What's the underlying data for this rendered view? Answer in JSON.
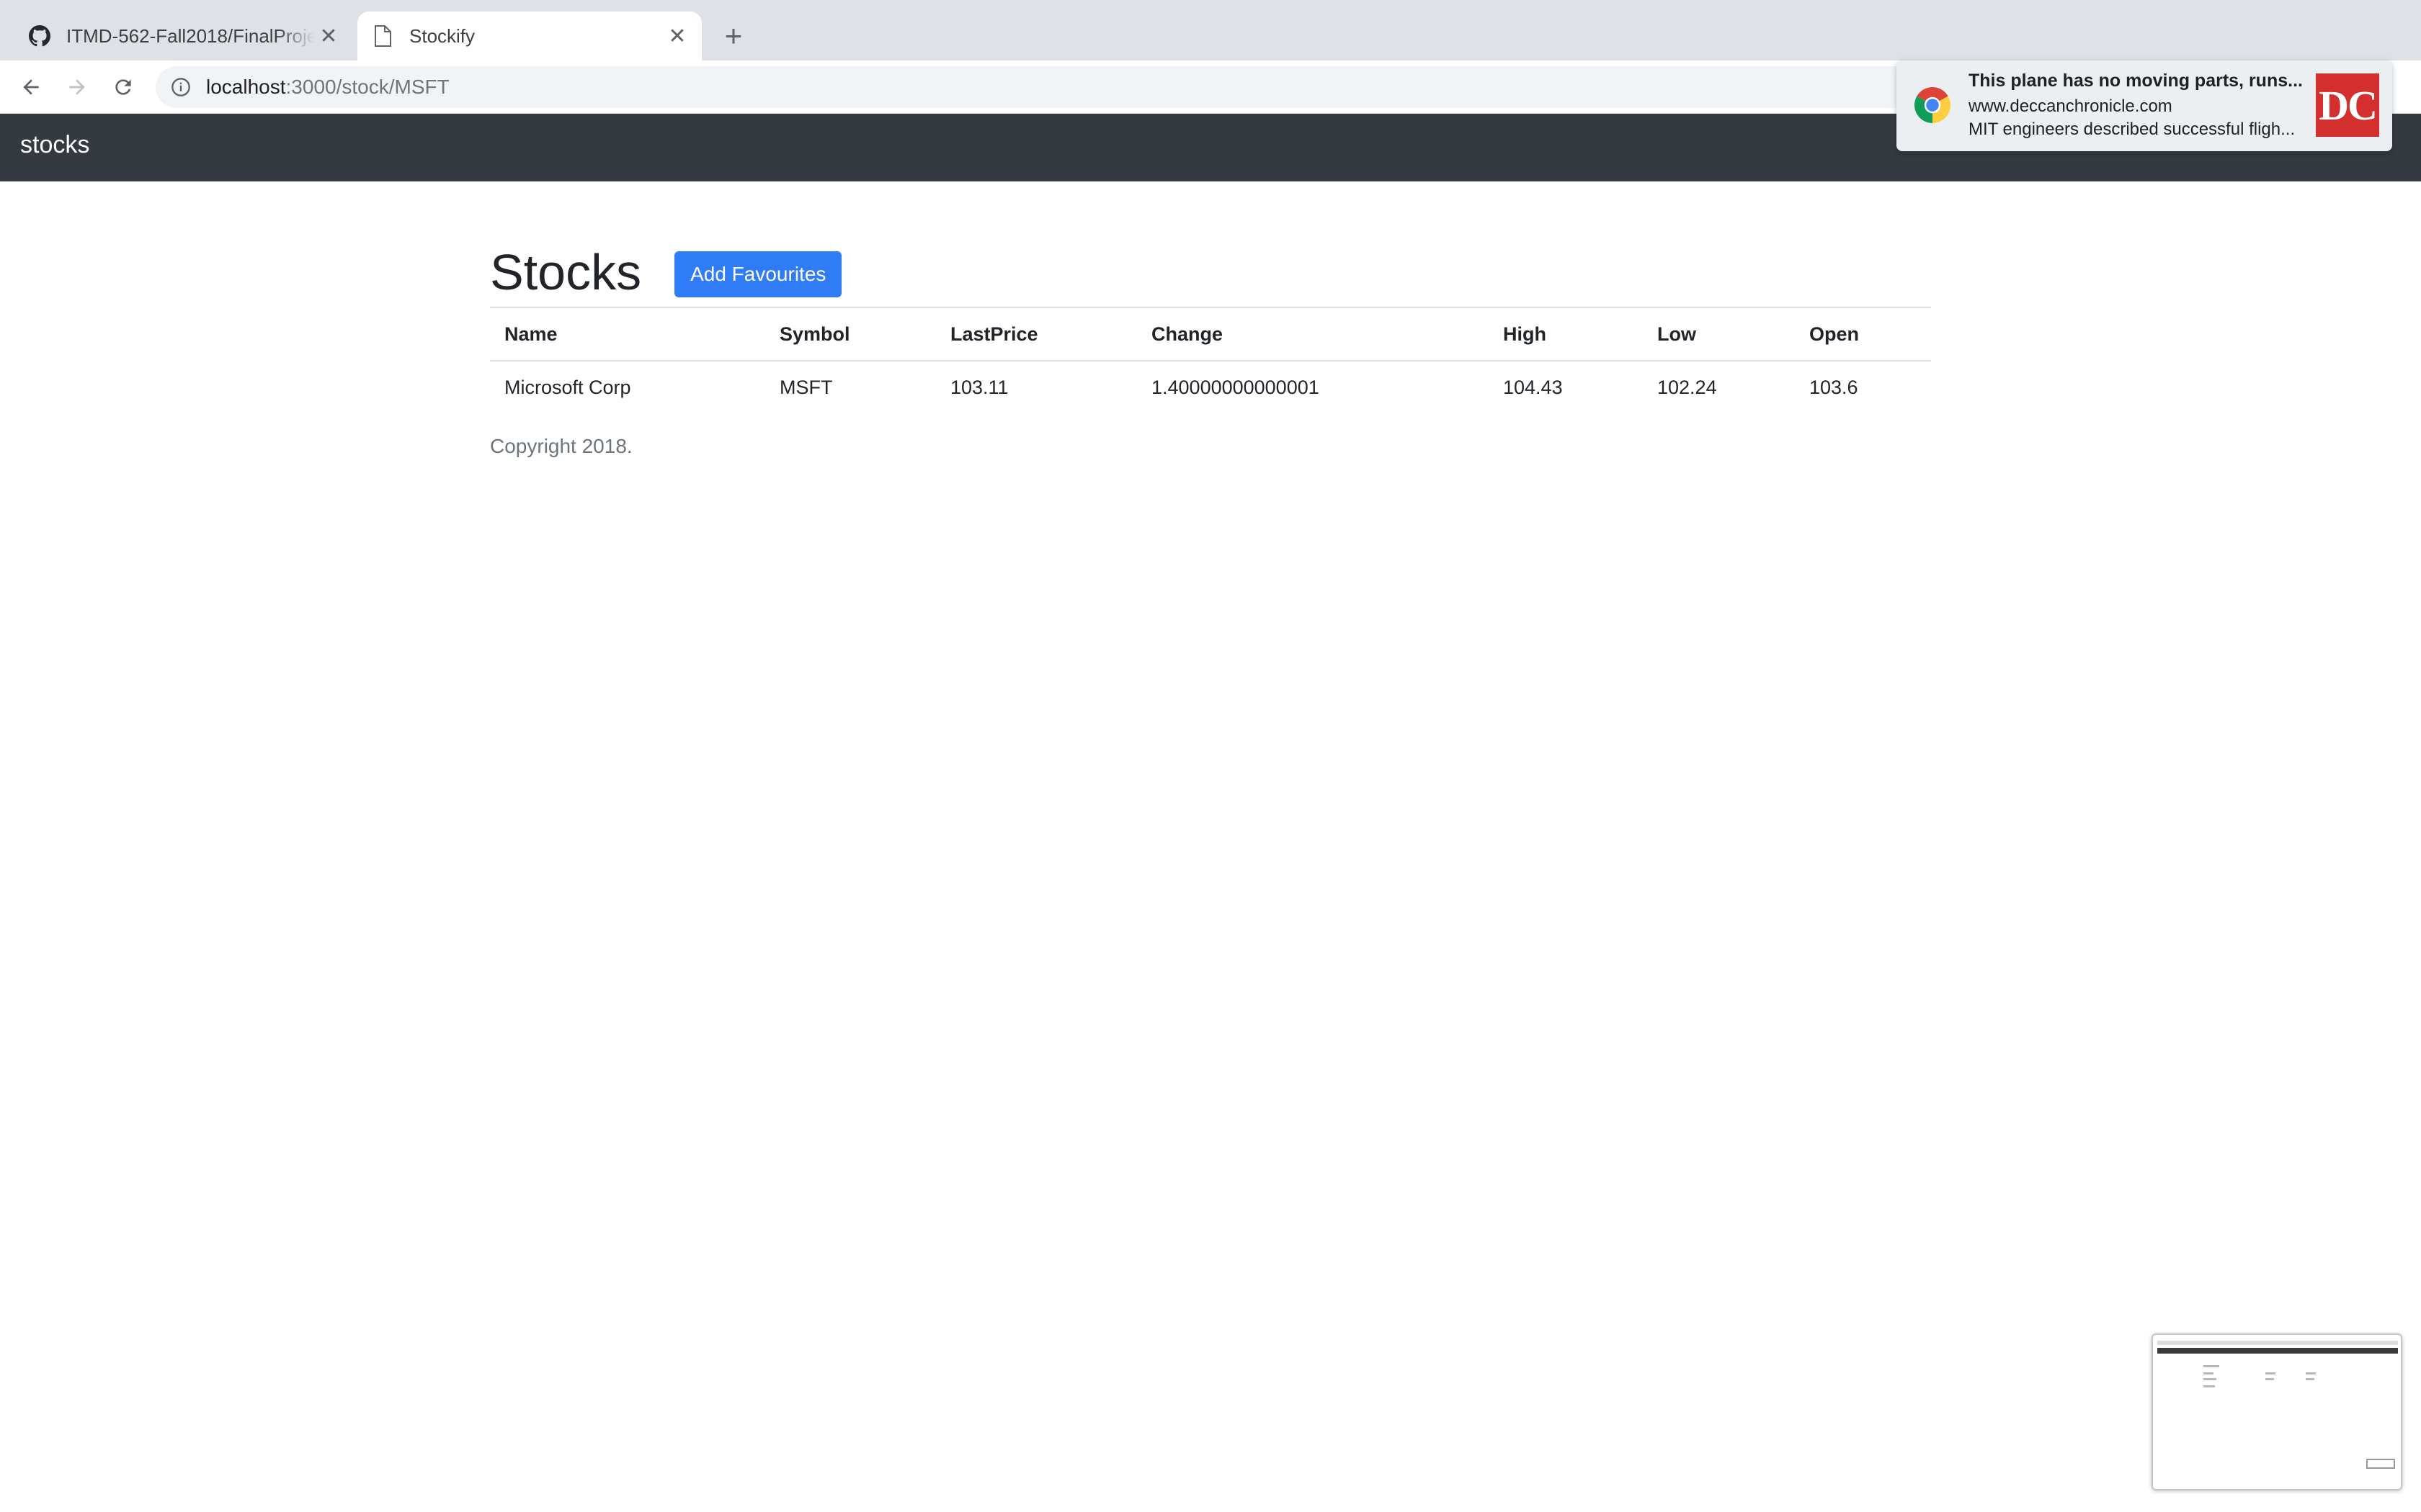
{
  "browser": {
    "tabs": [
      {
        "title": "ITMD-562-Fall2018/FinalProject",
        "icon": "github-icon",
        "active": false
      },
      {
        "title": "Stockify",
        "icon": "document-icon",
        "active": true
      }
    ],
    "url_host": "localhost",
    "url_path": ":3000/stock/MSFT"
  },
  "navbar": {
    "brand": "stocks"
  },
  "main": {
    "heading": "Stocks",
    "add_button": "Add Favourites",
    "table": {
      "headers": [
        "Name",
        "Symbol",
        "LastPrice",
        "Change",
        "High",
        "Low",
        "Open"
      ],
      "rows": [
        [
          "Microsoft Corp",
          "MSFT",
          "103.11",
          "1.40000000000001",
          "104.43",
          "102.24",
          "103.6"
        ]
      ]
    },
    "footer": "Copyright 2018."
  },
  "notification": {
    "title": "This plane has no moving parts, runs...",
    "source": "www.deccanchronicle.com",
    "snippet": "MIT engineers described successful fligh...",
    "logo_text": "DC"
  },
  "colors": {
    "navbar_bg": "#343a40",
    "primary_button": "#2f7cf6",
    "tabstrip_bg": "#dee1e6",
    "dc_logo_red": "#d32f2f"
  }
}
